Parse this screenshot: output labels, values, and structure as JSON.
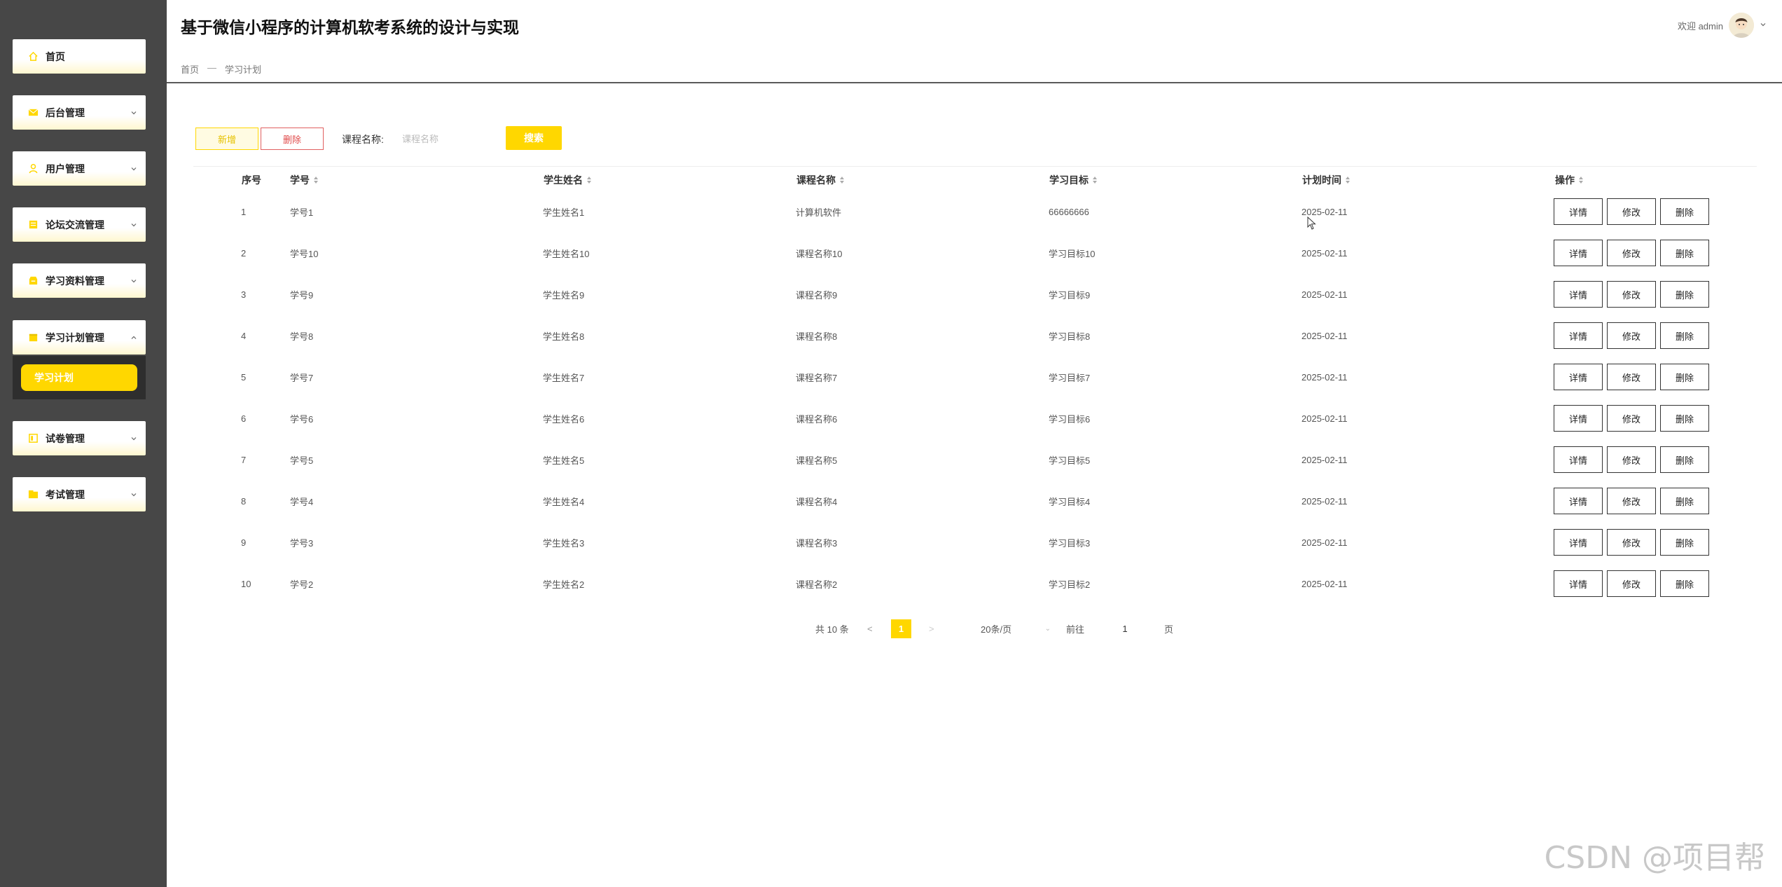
{
  "header": {
    "title": "基于微信小程序的计算机软考系统的设计与实现",
    "welcome": "欢迎 admin"
  },
  "breadcrumb": {
    "home": "首页",
    "sep": "—",
    "current": "学习计划"
  },
  "sidebar": {
    "items": [
      {
        "label": "首页",
        "icon": "home-icon"
      },
      {
        "label": "后台管理",
        "icon": "mail-icon"
      },
      {
        "label": "用户管理",
        "icon": "user-icon"
      },
      {
        "label": "论坛交流管理",
        "icon": "forum-icon"
      },
      {
        "label": "学习资料管理",
        "icon": "archive-icon"
      },
      {
        "label": "学习计划管理",
        "icon": "plan-icon"
      },
      {
        "label": "试卷管理",
        "icon": "paper-icon"
      },
      {
        "label": "考试管理",
        "icon": "exam-icon"
      }
    ],
    "submenu_active": "学习计划"
  },
  "toolbar": {
    "add_label": "新增",
    "delete_label": "删除",
    "search_label": "课程名称:",
    "search_placeholder": "课程名称",
    "search_button": "搜索"
  },
  "table": {
    "headers": [
      "序号",
      "学号",
      "学生姓名",
      "课程名称",
      "学习目标",
      "计划时间",
      "操作"
    ],
    "rows": [
      [
        "1",
        "学号1",
        "学生姓名1",
        "计算机软件",
        "66666666",
        "2025-02-11"
      ],
      [
        "2",
        "学号10",
        "学生姓名10",
        "课程名称10",
        "学习目标10",
        "2025-02-11"
      ],
      [
        "3",
        "学号9",
        "学生姓名9",
        "课程名称9",
        "学习目标9",
        "2025-02-11"
      ],
      [
        "4",
        "学号8",
        "学生姓名8",
        "课程名称8",
        "学习目标8",
        "2025-02-11"
      ],
      [
        "5",
        "学号7",
        "学生姓名7",
        "课程名称7",
        "学习目标7",
        "2025-02-11"
      ],
      [
        "6",
        "学号6",
        "学生姓名6",
        "课程名称6",
        "学习目标6",
        "2025-02-11"
      ],
      [
        "7",
        "学号5",
        "学生姓名5",
        "课程名称5",
        "学习目标5",
        "2025-02-11"
      ],
      [
        "8",
        "学号4",
        "学生姓名4",
        "课程名称4",
        "学习目标4",
        "2025-02-11"
      ],
      [
        "9",
        "学号3",
        "学生姓名3",
        "课程名称3",
        "学习目标3",
        "2025-02-11"
      ],
      [
        "10",
        "学号2",
        "学生姓名2",
        "课程名称2",
        "学习目标2",
        "2025-02-11"
      ]
    ],
    "actions": [
      "详情",
      "修改",
      "删除"
    ]
  },
  "pagination": {
    "total": "共 10 条",
    "prev": "<",
    "current": "1",
    "next": ">",
    "page_size": "20条/页",
    "goto": "前往",
    "goto_value": "1",
    "unit": "页"
  },
  "watermark": "CSDN @项目帮",
  "colors": {
    "accent": "#ffd700",
    "sidebar": "#474747",
    "danger": "#e04a4a"
  }
}
